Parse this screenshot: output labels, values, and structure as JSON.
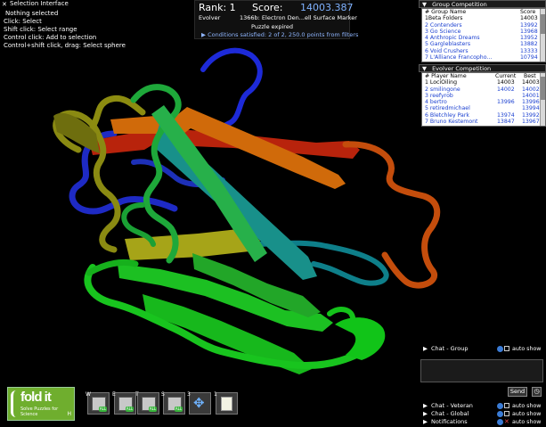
{
  "selection_panel": {
    "title": "Selection Interface",
    "lines": [
      "Nothing selected",
      "Click: Select",
      "Shift click: Select range",
      "Control click: Add to selection",
      "Control+shift click, drag: Select sphere"
    ]
  },
  "score_panel": {
    "rank_label": "Rank: 1",
    "score_label": "Score:",
    "score_value": "14003.387",
    "evolver_label": "Evolver",
    "puzzle_name": "1366b: Electron Den...ell Surface Marker",
    "status": "Puzzle expired",
    "conditions": "Conditions satisfied: 2 of 2, 250.0 points from filters"
  },
  "group_competition": {
    "title": "Group Competition",
    "headers": [
      "# Group Name",
      "Score"
    ],
    "rows": [
      {
        "name": "1Beta Folders",
        "score": "14003"
      },
      {
        "name": "2 Contenders",
        "score": "13992"
      },
      {
        "name": "3 Go Science",
        "score": "13968"
      },
      {
        "name": "4 Anthropic Dreams",
        "score": "13952"
      },
      {
        "name": "5 Gargleblasters",
        "score": "13882"
      },
      {
        "name": "6 Void Crushers",
        "score": "13333"
      },
      {
        "name": "7 L'Alliance Francopho...",
        "score": "10794"
      }
    ]
  },
  "evolver_competition": {
    "title": "Evolver Competition",
    "headers": [
      "# Player Name",
      "Current",
      "Best"
    ],
    "rows": [
      {
        "name": "1 LociOiling",
        "current": "14003",
        "best": "14003"
      },
      {
        "name": "2 smilingone",
        "current": "14002",
        "best": "14002"
      },
      {
        "name": "3 reefyrob",
        "current": "",
        "best": "14001"
      },
      {
        "name": "4 bertro",
        "current": "13996",
        "best": "13996"
      },
      {
        "name": "5 retiredmichael",
        "current": "",
        "best": "13994"
      },
      {
        "name": "6 Bletchley Park",
        "current": "13974",
        "best": "13992"
      },
      {
        "name": "7 Bruno Kestemont",
        "current": "13847",
        "best": "13967"
      }
    ]
  },
  "chat": {
    "group_label": "Chat - Group",
    "veteran_label": "Chat - Veteran",
    "global_label": "Chat - Global",
    "notifications_label": "Notifications",
    "auto_show": "auto show",
    "send_label": "Send"
  },
  "toolbar": {
    "keys": [
      "W",
      "E",
      "T",
      "S",
      "3",
      "1"
    ],
    "badge": "ALL"
  },
  "logo": {
    "name": "fold it",
    "tagline": "Solve Puzzles for Science",
    "badge": "H"
  },
  "colors": {
    "score_blue": "#7fb2ff",
    "table_text": "#1a3fd0",
    "green": "#1fbf2a"
  }
}
